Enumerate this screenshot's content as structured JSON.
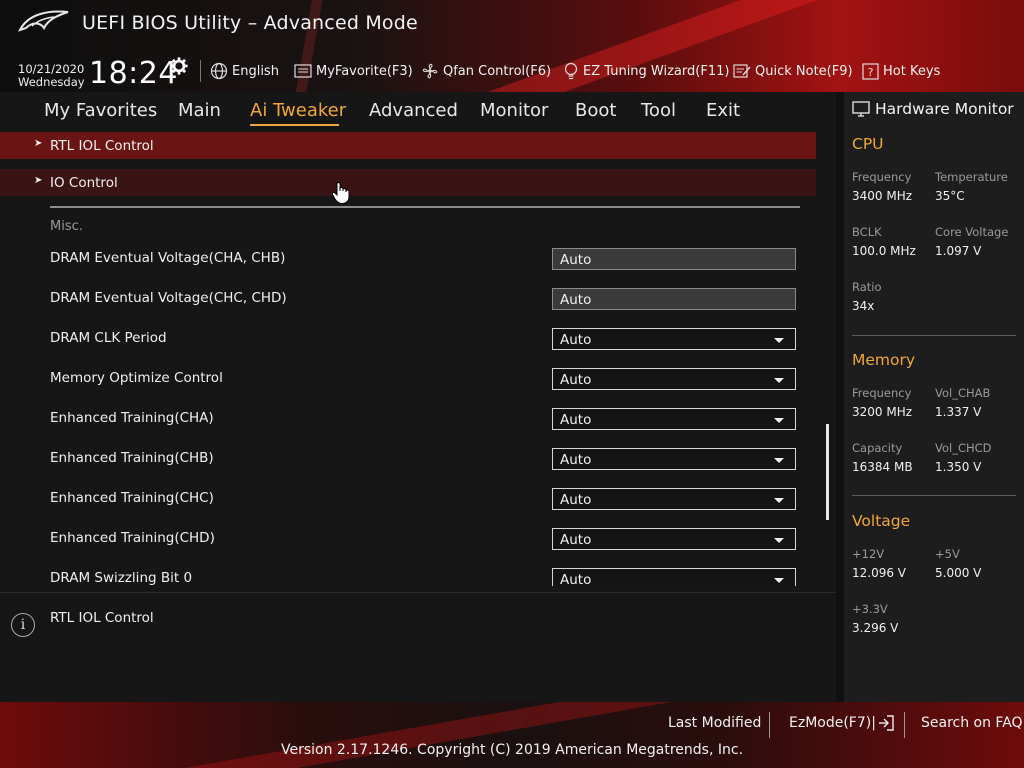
{
  "header": {
    "title": "UEFI BIOS Utility – Advanced Mode",
    "date": "10/21/2020",
    "weekday": "Wednesday",
    "time": "18:24",
    "tools": [
      {
        "label": "English",
        "icon": "globe-icon"
      },
      {
        "label": "MyFavorite(F3)",
        "icon": "favorite-list-icon"
      },
      {
        "label": "Qfan Control(F6)",
        "icon": "fan-icon"
      },
      {
        "label": "EZ Tuning Wizard(F11)",
        "icon": "lightbulb-icon"
      },
      {
        "label": "Quick Note(F9)",
        "icon": "note-icon"
      },
      {
        "label": "Hot Keys",
        "icon": "question-icon"
      }
    ]
  },
  "menu": {
    "tabs": [
      "My Favorites",
      "Main",
      "Ai Tweaker",
      "Advanced",
      "Monitor",
      "Boot",
      "Tool",
      "Exit"
    ],
    "active": "Ai Tweaker"
  },
  "content": {
    "submenus": [
      "RTL IOL Control",
      "IO Control"
    ],
    "section": "Misc.",
    "settings": [
      {
        "label": "DRAM Eventual Voltage(CHA, CHB)",
        "value": "Auto",
        "kind": "input"
      },
      {
        "label": "DRAM Eventual Voltage(CHC, CHD)",
        "value": "Auto",
        "kind": "input"
      },
      {
        "label": "DRAM CLK Period",
        "value": "Auto",
        "kind": "select"
      },
      {
        "label": "Memory Optimize Control",
        "value": "Auto",
        "kind": "select"
      },
      {
        "label": "Enhanced Training(CHA)",
        "value": "Auto",
        "kind": "select"
      },
      {
        "label": "Enhanced Training(CHB)",
        "value": "Auto",
        "kind": "select"
      },
      {
        "label": "Enhanced Training(CHC)",
        "value": "Auto",
        "kind": "select"
      },
      {
        "label": "Enhanced Training(CHD)",
        "value": "Auto",
        "kind": "select"
      },
      {
        "label": "DRAM Swizzling Bit 0",
        "value": "Auto",
        "kind": "select"
      }
    ]
  },
  "help": {
    "text": "RTL IOL Control"
  },
  "hardware_monitor": {
    "title": "Hardware Monitor",
    "cpu": {
      "title": "CPU",
      "frequency_label": "Frequency",
      "frequency": "3400 MHz",
      "temperature_label": "Temperature",
      "temperature": "35°C",
      "bclk_label": "BCLK",
      "bclk": "100.0 MHz",
      "core_voltage_label": "Core Voltage",
      "core_voltage": "1.097 V",
      "ratio_label": "Ratio",
      "ratio": "34x"
    },
    "memory": {
      "title": "Memory",
      "frequency_label": "Frequency",
      "frequency": "3200 MHz",
      "vol_chab_label": "Vol_CHAB",
      "vol_chab": "1.337 V",
      "capacity_label": "Capacity",
      "capacity": "16384 MB",
      "vol_chcd_label": "Vol_CHCD",
      "vol_chcd": "1.350 V"
    },
    "voltage": {
      "title": "Voltage",
      "v12_label": "+12V",
      "v12": "12.096 V",
      "v5_label": "+5V",
      "v5": "5.000 V",
      "v33_label": "+3.3V",
      "v33": "3.296 V"
    }
  },
  "footer": {
    "last_modified": "Last Modified",
    "ezmode": "EzMode(F7)|",
    "search_faq": "Search on FAQ",
    "copyright": "Version 2.17.1246. Copyright (C) 2019 American Megatrends, Inc."
  },
  "colors": {
    "accent": "#f0a73a",
    "brand_red": "#a31212"
  }
}
